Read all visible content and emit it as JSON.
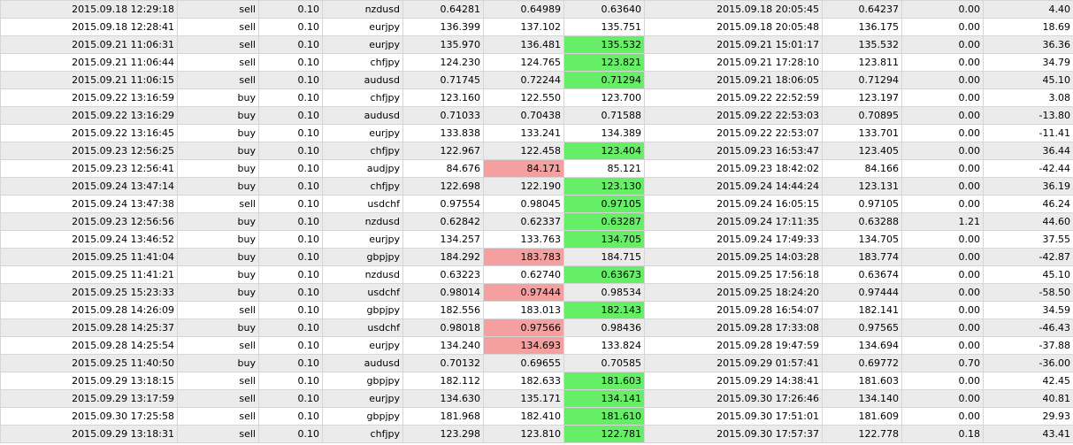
{
  "colors": {
    "stripe": "#ebebeb",
    "green": "#66ee66",
    "red": "#f4a0a0"
  },
  "rows": [
    {
      "open_time": "2015.09.18 12:29:18",
      "type": "sell",
      "volume": "0.10",
      "symbol": "nzdusd",
      "open_price": "0.64281",
      "sl": "0.64989",
      "tp": "0.63640",
      "close_time": "2015.09.18 20:05:45",
      "close_price": "0.64237",
      "swap": "0.00",
      "profit": "4.40",
      "hl": "",
      "hl_col": ""
    },
    {
      "open_time": "2015.09.18 12:28:41",
      "type": "sell",
      "volume": "0.10",
      "symbol": "eurjpy",
      "open_price": "136.399",
      "sl": "137.102",
      "tp": "135.751",
      "close_time": "2015.09.18 20:05:48",
      "close_price": "136.175",
      "swap": "0.00",
      "profit": "18.69",
      "hl": "",
      "hl_col": ""
    },
    {
      "open_time": "2015.09.21 11:06:31",
      "type": "sell",
      "volume": "0.10",
      "symbol": "eurjpy",
      "open_price": "135.970",
      "sl": "136.481",
      "tp": "135.532",
      "close_time": "2015.09.21 15:01:17",
      "close_price": "135.532",
      "swap": "0.00",
      "profit": "36.36",
      "hl": "green",
      "hl_col": "tp"
    },
    {
      "open_time": "2015.09.21 11:06:44",
      "type": "sell",
      "volume": "0.10",
      "symbol": "chfjpy",
      "open_price": "124.230",
      "sl": "124.765",
      "tp": "123.821",
      "close_time": "2015.09.21 17:28:10",
      "close_price": "123.811",
      "swap": "0.00",
      "profit": "34.79",
      "hl": "green",
      "hl_col": "tp"
    },
    {
      "open_time": "2015.09.21 11:06:15",
      "type": "sell",
      "volume": "0.10",
      "symbol": "audusd",
      "open_price": "0.71745",
      "sl": "0.72244",
      "tp": "0.71294",
      "close_time": "2015.09.21 18:06:05",
      "close_price": "0.71294",
      "swap": "0.00",
      "profit": "45.10",
      "hl": "green",
      "hl_col": "tp"
    },
    {
      "open_time": "2015.09.22 13:16:59",
      "type": "buy",
      "volume": "0.10",
      "symbol": "chfjpy",
      "open_price": "123.160",
      "sl": "122.550",
      "tp": "123.700",
      "close_time": "2015.09.22 22:52:59",
      "close_price": "123.197",
      "swap": "0.00",
      "profit": "3.08",
      "hl": "",
      "hl_col": ""
    },
    {
      "open_time": "2015.09.22 13:16:29",
      "type": "buy",
      "volume": "0.10",
      "symbol": "audusd",
      "open_price": "0.71033",
      "sl": "0.70438",
      "tp": "0.71588",
      "close_time": "2015.09.22 22:53:03",
      "close_price": "0.70895",
      "swap": "0.00",
      "profit": "-13.80",
      "hl": "",
      "hl_col": ""
    },
    {
      "open_time": "2015.09.22 13:16:45",
      "type": "buy",
      "volume": "0.10",
      "symbol": "eurjpy",
      "open_price": "133.838",
      "sl": "133.241",
      "tp": "134.389",
      "close_time": "2015.09.22 22:53:07",
      "close_price": "133.701",
      "swap": "0.00",
      "profit": "-11.41",
      "hl": "",
      "hl_col": ""
    },
    {
      "open_time": "2015.09.23 12:56:25",
      "type": "buy",
      "volume": "0.10",
      "symbol": "chfjpy",
      "open_price": "122.967",
      "sl": "122.458",
      "tp": "123.404",
      "close_time": "2015.09.23 16:53:47",
      "close_price": "123.405",
      "swap": "0.00",
      "profit": "36.44",
      "hl": "green",
      "hl_col": "tp"
    },
    {
      "open_time": "2015.09.23 12:56:41",
      "type": "buy",
      "volume": "0.10",
      "symbol": "audjpy",
      "open_price": "84.676",
      "sl": "84.171",
      "tp": "85.121",
      "close_time": "2015.09.23 18:42:02",
      "close_price": "84.166",
      "swap": "0.00",
      "profit": "-42.44",
      "hl": "red",
      "hl_col": "sl"
    },
    {
      "open_time": "2015.09.24 13:47:14",
      "type": "buy",
      "volume": "0.10",
      "symbol": "chfjpy",
      "open_price": "122.698",
      "sl": "122.190",
      "tp": "123.130",
      "close_time": "2015.09.24 14:44:24",
      "close_price": "123.131",
      "swap": "0.00",
      "profit": "36.19",
      "hl": "green",
      "hl_col": "tp"
    },
    {
      "open_time": "2015.09.24 13:47:38",
      "type": "sell",
      "volume": "0.10",
      "symbol": "usdchf",
      "open_price": "0.97554",
      "sl": "0.98045",
      "tp": "0.97105",
      "close_time": "2015.09.24 16:05:15",
      "close_price": "0.97105",
      "swap": "0.00",
      "profit": "46.24",
      "hl": "green",
      "hl_col": "tp"
    },
    {
      "open_time": "2015.09.23 12:56:56",
      "type": "buy",
      "volume": "0.10",
      "symbol": "nzdusd",
      "open_price": "0.62842",
      "sl": "0.62337",
      "tp": "0.63287",
      "close_time": "2015.09.24 17:11:35",
      "close_price": "0.63288",
      "swap": "1.21",
      "profit": "44.60",
      "hl": "green",
      "hl_col": "tp"
    },
    {
      "open_time": "2015.09.24 13:46:52",
      "type": "buy",
      "volume": "0.10",
      "symbol": "eurjpy",
      "open_price": "134.257",
      "sl": "133.763",
      "tp": "134.705",
      "close_time": "2015.09.24 17:49:33",
      "close_price": "134.705",
      "swap": "0.00",
      "profit": "37.55",
      "hl": "green",
      "hl_col": "tp"
    },
    {
      "open_time": "2015.09.25 11:41:04",
      "type": "buy",
      "volume": "0.10",
      "symbol": "gbpjpy",
      "open_price": "184.292",
      "sl": "183.783",
      "tp": "184.715",
      "close_time": "2015.09.25 14:03:28",
      "close_price": "183.774",
      "swap": "0.00",
      "profit": "-42.87",
      "hl": "red",
      "hl_col": "sl"
    },
    {
      "open_time": "2015.09.25 11:41:21",
      "type": "buy",
      "volume": "0.10",
      "symbol": "nzdusd",
      "open_price": "0.63223",
      "sl": "0.62740",
      "tp": "0.63673",
      "close_time": "2015.09.25 17:56:18",
      "close_price": "0.63674",
      "swap": "0.00",
      "profit": "45.10",
      "hl": "green",
      "hl_col": "tp"
    },
    {
      "open_time": "2015.09.25 15:23:33",
      "type": "buy",
      "volume": "0.10",
      "symbol": "usdchf",
      "open_price": "0.98014",
      "sl": "0.97444",
      "tp": "0.98534",
      "close_time": "2015.09.25 18:24:20",
      "close_price": "0.97444",
      "swap": "0.00",
      "profit": "-58.50",
      "hl": "red",
      "hl_col": "sl"
    },
    {
      "open_time": "2015.09.28 14:26:09",
      "type": "sell",
      "volume": "0.10",
      "symbol": "gbpjpy",
      "open_price": "182.556",
      "sl": "183.013",
      "tp": "182.143",
      "close_time": "2015.09.28 16:54:07",
      "close_price": "182.141",
      "swap": "0.00",
      "profit": "34.59",
      "hl": "green",
      "hl_col": "tp"
    },
    {
      "open_time": "2015.09.28 14:25:37",
      "type": "buy",
      "volume": "0.10",
      "symbol": "usdchf",
      "open_price": "0.98018",
      "sl": "0.97566",
      "tp": "0.98436",
      "close_time": "2015.09.28 17:33:08",
      "close_price": "0.97565",
      "swap": "0.00",
      "profit": "-46.43",
      "hl": "red",
      "hl_col": "sl"
    },
    {
      "open_time": "2015.09.28 14:25:54",
      "type": "sell",
      "volume": "0.10",
      "symbol": "eurjpy",
      "open_price": "134.240",
      "sl": "134.693",
      "tp": "133.824",
      "close_time": "2015.09.28 19:47:59",
      "close_price": "134.694",
      "swap": "0.00",
      "profit": "-37.88",
      "hl": "red",
      "hl_col": "sl"
    },
    {
      "open_time": "2015.09.25 11:40:50",
      "type": "buy",
      "volume": "0.10",
      "symbol": "audusd",
      "open_price": "0.70132",
      "sl": "0.69655",
      "tp": "0.70585",
      "close_time": "2015.09.29 01:57:41",
      "close_price": "0.69772",
      "swap": "0.70",
      "profit": "-36.00",
      "hl": "",
      "hl_col": ""
    },
    {
      "open_time": "2015.09.29 13:18:15",
      "type": "sell",
      "volume": "0.10",
      "symbol": "gbpjpy",
      "open_price": "182.112",
      "sl": "182.633",
      "tp": "181.603",
      "close_time": "2015.09.29 14:38:41",
      "close_price": "181.603",
      "swap": "0.00",
      "profit": "42.45",
      "hl": "green",
      "hl_col": "tp"
    },
    {
      "open_time": "2015.09.29 13:17:59",
      "type": "sell",
      "volume": "0.10",
      "symbol": "eurjpy",
      "open_price": "134.630",
      "sl": "135.171",
      "tp": "134.141",
      "close_time": "2015.09.30 17:26:46",
      "close_price": "134.140",
      "swap": "0.00",
      "profit": "40.81",
      "hl": "green",
      "hl_col": "tp"
    },
    {
      "open_time": "2015.09.30 17:25:58",
      "type": "sell",
      "volume": "0.10",
      "symbol": "gbpjpy",
      "open_price": "181.968",
      "sl": "182.410",
      "tp": "181.610",
      "close_time": "2015.09.30 17:51:01",
      "close_price": "181.609",
      "swap": "0.00",
      "profit": "29.93",
      "hl": "green",
      "hl_col": "tp"
    },
    {
      "open_time": "2015.09.29 13:18:31",
      "type": "sell",
      "volume": "0.10",
      "symbol": "chfjpy",
      "open_price": "123.298",
      "sl": "123.810",
      "tp": "122.781",
      "close_time": "2015.09.30 17:57:37",
      "close_price": "122.778",
      "swap": "0.18",
      "profit": "43.41",
      "hl": "green",
      "hl_col": "tp"
    }
  ]
}
